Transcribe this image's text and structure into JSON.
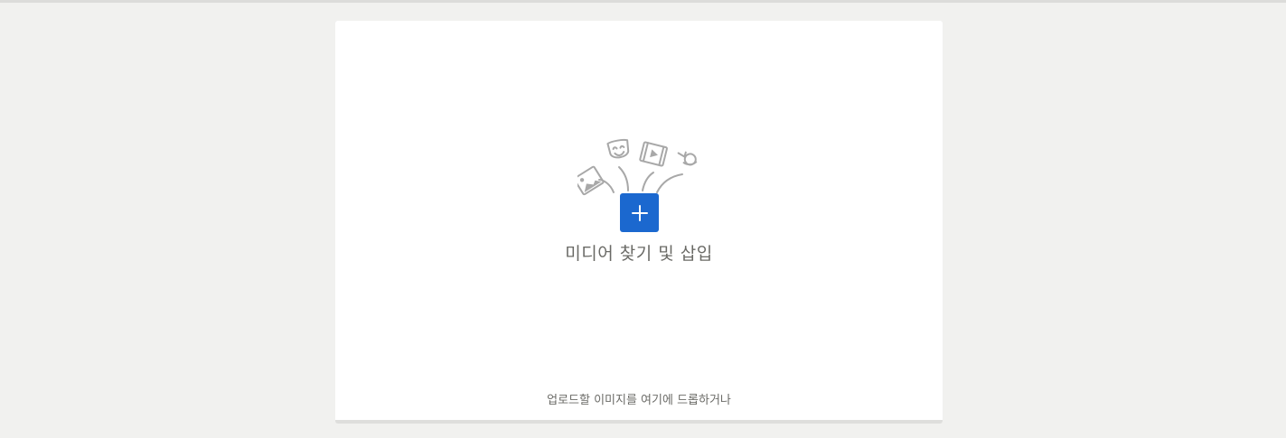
{
  "media_panel": {
    "find_insert_label": "미디어 찾기 및 삽입",
    "drop_hint": "업로드할 이미지를 여기에 드롭하거나"
  },
  "icons": {
    "add": "plus-icon",
    "image": "image-icon",
    "masks": "theater-masks-icon",
    "video": "film-icon",
    "audio": "audio-icon"
  },
  "colors": {
    "accent": "#1b68cf",
    "background": "#f1f1ef",
    "card": "#ffffff",
    "illustration_stroke": "#a8a8a8"
  }
}
